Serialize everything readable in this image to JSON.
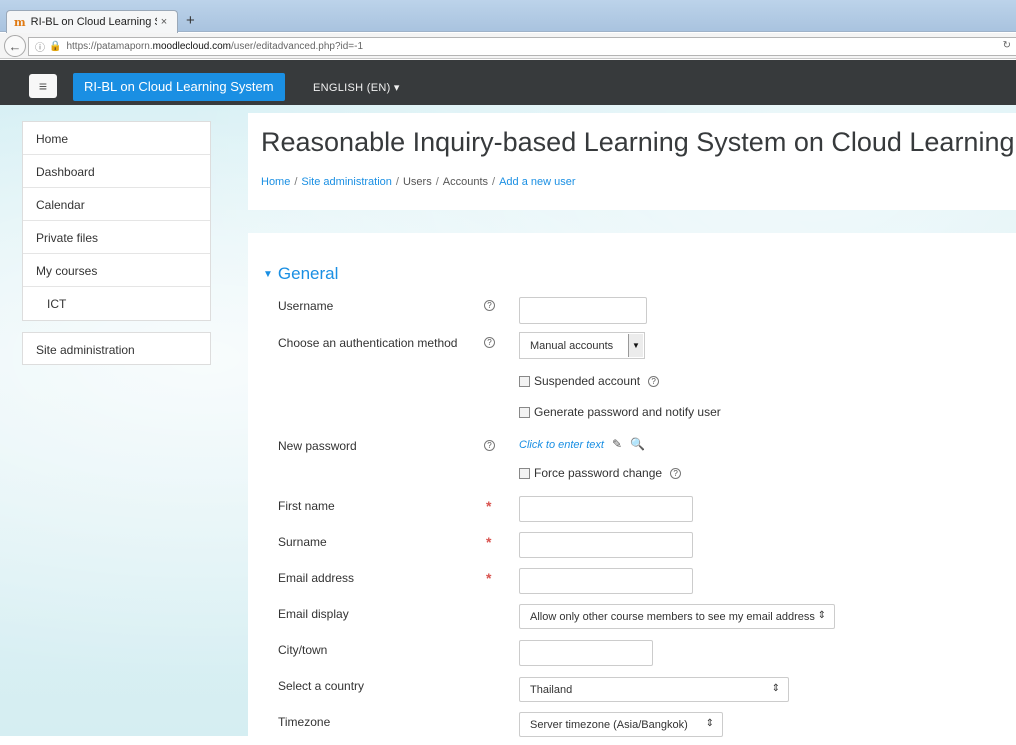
{
  "browser": {
    "tab_title": "RI-BL on Cloud Learning S...",
    "tab_close": "×",
    "new_tab": "+",
    "url": {
      "prefix": "https://patamaporn.",
      "host": "moodlecloud.com",
      "path": "/user/editadvanced.php?id=-1"
    }
  },
  "header": {
    "menu_icon": "≡",
    "site_name": "RI-BL on Cloud Learning System",
    "language": "ENGLISH (EN) ▾"
  },
  "sidebar": {
    "items": [
      {
        "label": "Home"
      },
      {
        "label": "Dashboard"
      },
      {
        "label": "Calendar"
      },
      {
        "label": "Private files"
      },
      {
        "label": "My courses"
      },
      {
        "label": "ICT"
      }
    ],
    "admin": "Site administration"
  },
  "page": {
    "title": "Reasonable Inquiry-based Learning System on Cloud Learning",
    "breadcrumb": [
      "Home",
      "Site administration",
      "Users",
      "Accounts",
      "Add a new user"
    ]
  },
  "form": {
    "section": "General",
    "username_label": "Username",
    "auth_label": "Choose an authentication method",
    "auth_value": "Manual accounts",
    "suspended_label": "Suspended account",
    "generate_label": "Generate password and notify user",
    "password_label": "New password",
    "password_link": "Click to enter text",
    "force_label": "Force password change",
    "firstname_label": "First name",
    "surname_label": "Surname",
    "email_label": "Email address",
    "emaildisplay_label": "Email display",
    "emaildisplay_value": "Allow only other course members to see my email address",
    "city_label": "City/town",
    "country_label": "Select a country",
    "country_value": "Thailand",
    "timezone_label": "Timezone",
    "timezone_value": "Server timezone (Asia/Bangkok)"
  },
  "icons": {
    "help": "help-circle-icon",
    "required": "asterisk-icon",
    "edit": "pencil-icon",
    "reveal": "magnifier-icon"
  }
}
